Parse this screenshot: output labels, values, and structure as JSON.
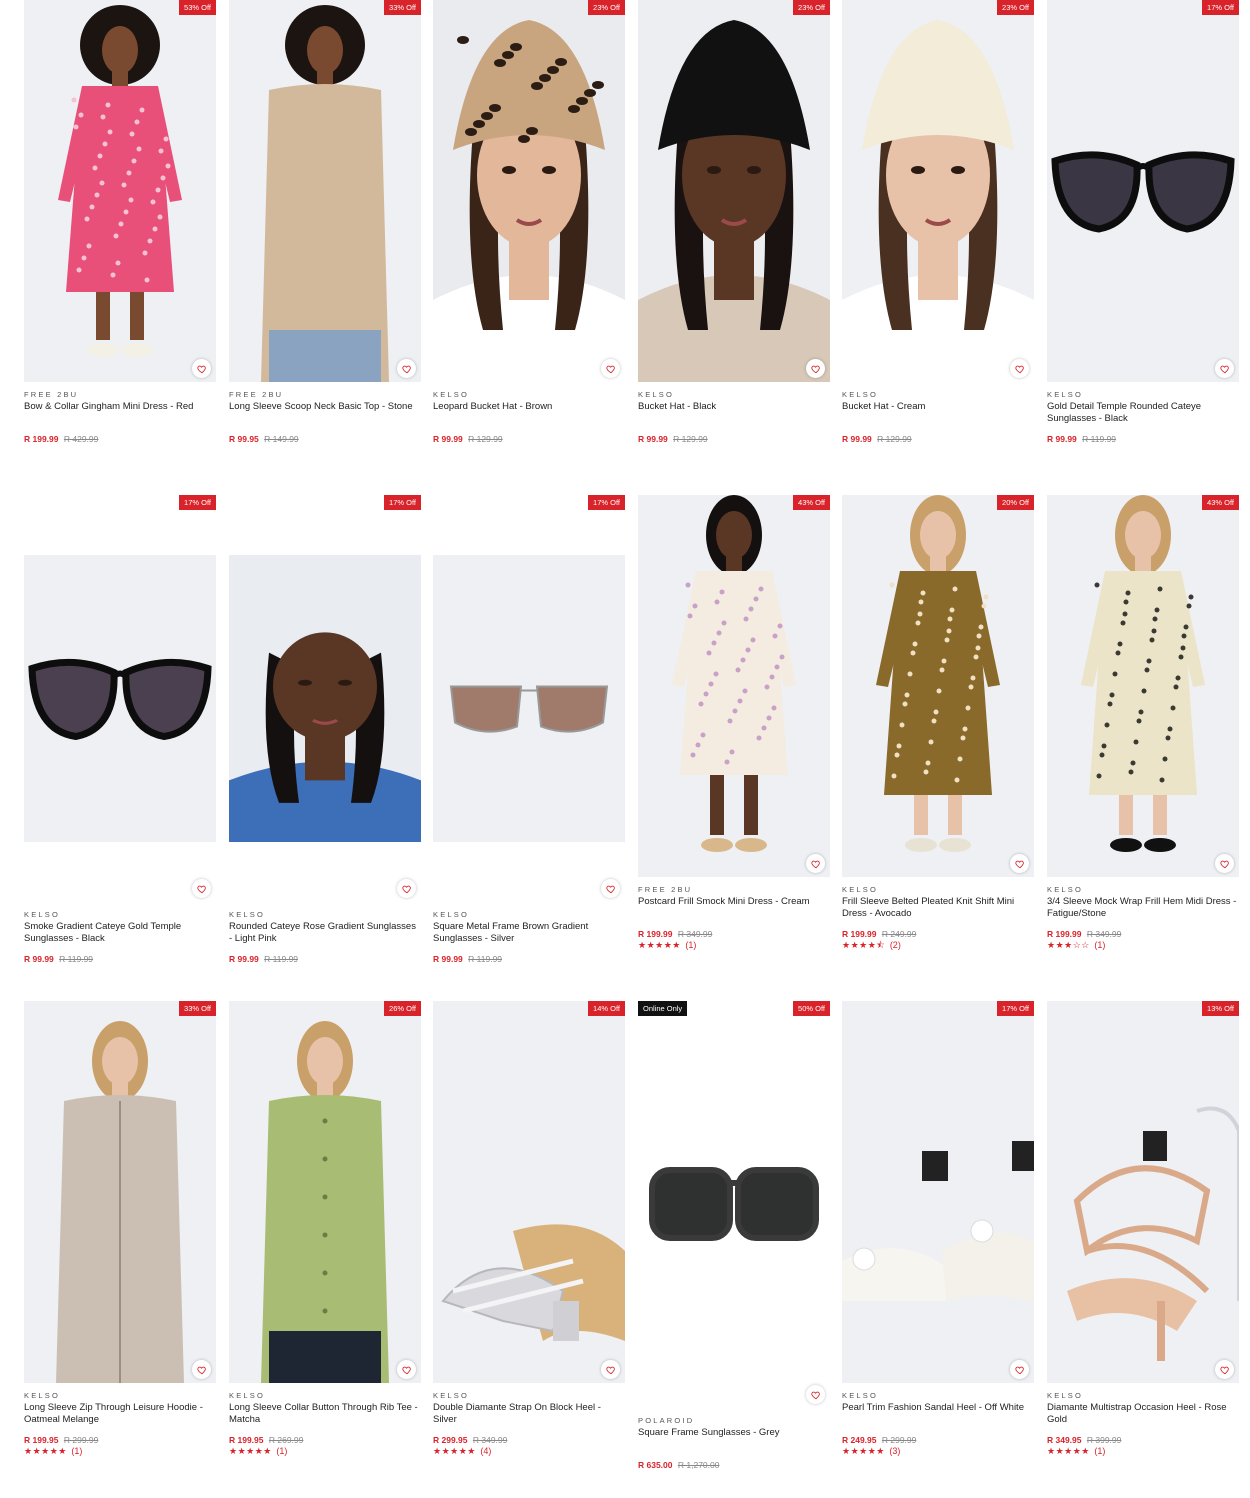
{
  "heart_icon": "heart-outline-icon",
  "accent_color": "#d8232a",
  "products": [
    {
      "brand": "FREE 2BU",
      "name": "Bow & Collar Gingham Mini Dress - Red",
      "price": "R 199.99",
      "old_price": "R 429.99",
      "badge": "53% Off",
      "image": "pink gingham dress"
    },
    {
      "brand": "FREE 2BU",
      "name": "Long Sleeve Scoop Neck Basic Top - Stone",
      "price": "R 99.95",
      "old_price": "R 149.99",
      "badge": "33% Off",
      "image": "stone long sleeve top"
    },
    {
      "brand": "KELSO",
      "name": "Leopard Bucket Hat - Brown",
      "price": "R 99.99",
      "old_price": "R 129.99",
      "badge": "23% Off",
      "image": "leopard bucket hat"
    },
    {
      "brand": "KELSO",
      "name": "Bucket Hat - Black",
      "price": "R 99.99",
      "old_price": "R 129.99",
      "badge": "23% Off",
      "image": "black bucket hat"
    },
    {
      "brand": "KELSO",
      "name": "Bucket Hat - Cream",
      "price": "R 99.99",
      "old_price": "R 129.99",
      "badge": "23% Off",
      "image": "cream bucket hat"
    },
    {
      "brand": "KELSO",
      "name": "Gold Detail Temple Rounded Cateye Sunglasses - Black",
      "price": "R 99.99",
      "old_price": "R 119.99",
      "badge": "17% Off",
      "image": "black cateye sunglasses"
    },
    {
      "brand": "KELSO",
      "name": "Smoke Gradient Cateye Gold Temple Sunglasses - Black",
      "price": "R 99.99",
      "old_price": "R 119.99",
      "badge": "17% Off",
      "image": "smoke cateye sunglasses"
    },
    {
      "brand": "KELSO",
      "name": "Rounded Cateye Rose Gradient Sunglasses - Light Pink",
      "price": "R 99.99",
      "old_price": "R 119.99",
      "badge": "17% Off",
      "image": "rose sunglasses model"
    },
    {
      "brand": "KELSO",
      "name": "Square Metal Frame Brown Gradient Sunglasses - Silver",
      "price": "R 99.99",
      "old_price": "R 119.99",
      "badge": "17% Off",
      "image": "silver metal sunglasses"
    },
    {
      "brand": "FREE 2BU",
      "name": "Postcard Frill Smock Mini Dress - Cream",
      "price": "R 199.99",
      "old_price": "R 349.99",
      "badge": "43% Off",
      "stars": "★★★★★",
      "reviews": "(1)",
      "image": "cream floral dress"
    },
    {
      "brand": "KELSO",
      "name": "Frill Sleeve Belted Pleated Knit Shift Mini Dress - Avocado",
      "price": "R 199.99",
      "old_price": "R 249.99",
      "badge": "20% Off",
      "stars": "★★★★⯪",
      "reviews": "(2)",
      "image": "avocado print dress"
    },
    {
      "brand": "KELSO",
      "name": "3/4 Sleeve Mock Wrap Frill Hem Midi Dress - Fatigue/Stone",
      "price": "R 199.99",
      "old_price": "R 349.99",
      "badge": "43% Off",
      "stars": "★★★☆☆",
      "reviews": "(1)",
      "image": "fatigue midi dress"
    },
    {
      "brand": "KELSO",
      "name": "Long Sleeve Zip Through Leisure Hoodie - Oatmeal Melange",
      "price": "R 199.95",
      "old_price": "R 299.99",
      "badge": "33% Off",
      "stars": "★★★★★",
      "reviews": "(1)",
      "image": "oatmeal hoodie"
    },
    {
      "brand": "KELSO",
      "name": "Long Sleeve Collar Button Through Rib Tee - Matcha",
      "price": "R 199.95",
      "old_price": "R 269.99",
      "badge": "26% Off",
      "stars": "★★★★★",
      "reviews": "(1)",
      "image": "matcha rib tee"
    },
    {
      "brand": "KELSO",
      "name": "Double Diamante Strap On Block Heel - Silver",
      "price": "R 299.95",
      "old_price": "R 349.99",
      "badge": "14% Off",
      "stars": "★★★★★",
      "reviews": "(4)",
      "image": "silver block heel"
    },
    {
      "brand": "POLAROID",
      "name": "Square Frame Sunglasses - Grey",
      "price": "R 635.00",
      "old_price": "R 1,270.00",
      "badge": "50% Off",
      "online_badge": "Online Only",
      "image": "grey square sunglasses"
    },
    {
      "brand": "KELSO",
      "name": "Pearl Trim Fashion Sandal Heel - Off White",
      "price": "R 249.95",
      "old_price": "R 299.99",
      "badge": "17% Off",
      "stars": "★★★★★",
      "reviews": "(3)",
      "image": "pearl sandal heel"
    },
    {
      "brand": "KELSO",
      "name": "Diamante Multistrap Occasion Heel - Rose Gold",
      "price": "R 349.95",
      "old_price": "R 399.99",
      "badge": "13% Off",
      "stars": "★★★★★",
      "reviews": "(1)",
      "image": "rose gold heel"
    }
  ]
}
